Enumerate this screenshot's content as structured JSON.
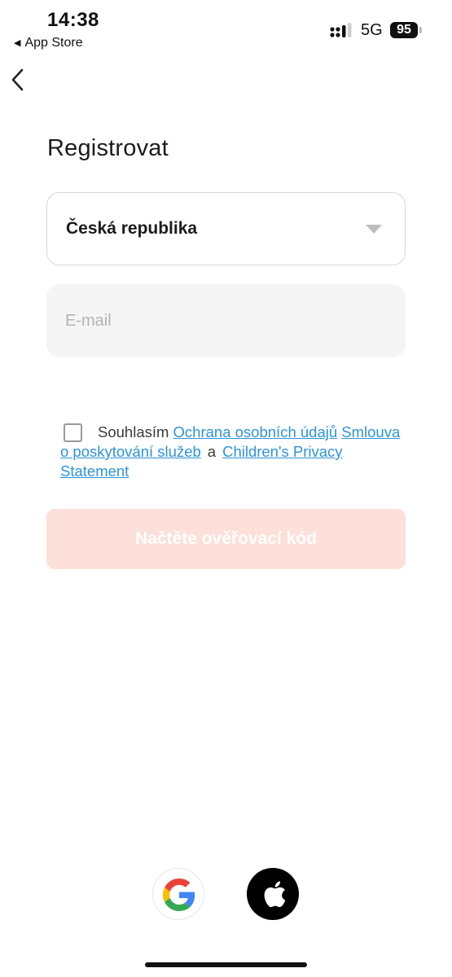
{
  "status_bar": {
    "time": "14:38",
    "back_app": "App Store",
    "network": "5G",
    "battery": "95"
  },
  "icons": {
    "nav_back": "chevron-left-icon",
    "dropdown": "caret-down-icon",
    "google": "google-icon",
    "apple": "apple-icon"
  },
  "page": {
    "title": "Registrovat"
  },
  "form": {
    "country": "Česká republika",
    "email_placeholder": "E-mail",
    "email_value": "",
    "consent": {
      "checked": false,
      "prefix": "Souhlasím",
      "privacy_link": "Ochrana osobních údajů",
      "terms_link": "Smlouva o poskytování služeb",
      "conjunction": "a",
      "children_link": "Children's Privacy Statement"
    },
    "submit_label": "Načtěte ověřovací kód"
  },
  "colors": {
    "link": "#2e93d8",
    "button_disabled_bg": "#fde0d9",
    "input_bg": "#f5f5f5"
  }
}
